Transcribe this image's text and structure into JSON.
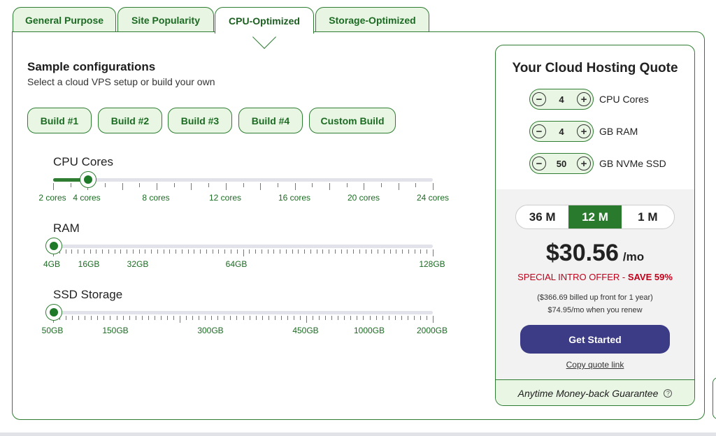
{
  "tabs": [
    {
      "label": "General Purpose"
    },
    {
      "label": "Site Popularity"
    },
    {
      "label": "CPU-Optimized"
    },
    {
      "label": "Storage-Optimized"
    }
  ],
  "active_tab": "CPU-Optimized",
  "sample": {
    "title": "Sample configurations",
    "subtitle": "Select a cloud VPS setup or build your own"
  },
  "builds": [
    "Build #1",
    "Build #2",
    "Build #3",
    "Build #4",
    "Custom Build"
  ],
  "sliders": {
    "cpu": {
      "label": "CPU Cores",
      "tick_labels": [
        "2 cores",
        "4 cores",
        "8 cores",
        "12 cores",
        "16 cores",
        "20 cores",
        "24 cores"
      ],
      "selected": "4 cores"
    },
    "ram": {
      "label": "RAM",
      "tick_labels": [
        "4GB",
        "16GB",
        "32GB",
        "64GB",
        "128GB"
      ],
      "selected": "4GB"
    },
    "ssd": {
      "label": "SSD Storage",
      "tick_labels": [
        "50GB",
        "150GB",
        "300GB",
        "450GB",
        "1000GB",
        "2000GB"
      ],
      "selected": "50GB"
    }
  },
  "quote": {
    "title": "Your Cloud Hosting Quote",
    "steppers": [
      {
        "value": "4",
        "unit": "CPU Cores"
      },
      {
        "value": "4",
        "unit": "GB RAM"
      },
      {
        "value": "50",
        "unit": "GB NVMe SSD"
      }
    ],
    "terms": [
      "36 M",
      "12 M",
      "1 M"
    ],
    "active_term": "12 M",
    "price": "$30.56",
    "per": "/mo",
    "offer_prefix": "SPECIAL INTRO OFFER - ",
    "offer_save": "SAVE 59%",
    "billed_line1": "($366.69 billed up front for 1 year)",
    "billed_line2": "$74.95/mo when you renew",
    "cta": "Get Started",
    "copy_link": "Copy quote link",
    "guarantee": "Anytime Money-back Guarantee",
    "help_glyph": "?"
  },
  "colors": {
    "accent_green": "#2e7d32",
    "tab_bg": "#e8f5e3",
    "cta_purple": "#3b3b86",
    "offer_red": "#c0001a"
  }
}
